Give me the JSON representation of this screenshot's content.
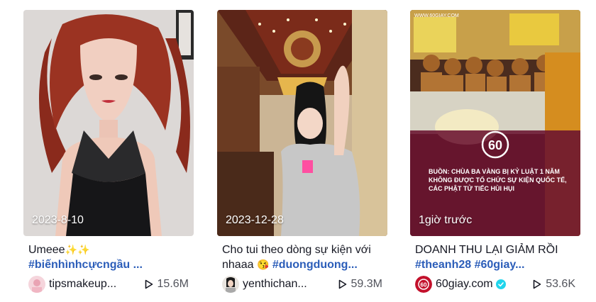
{
  "videos": [
    {
      "date": "2023-8-10",
      "caption_line1": "Umeee",
      "caption_emoji": "✨✨",
      "caption_line2": "#biếnhìnhcựcngầu ...",
      "author": "tipsmakeup...",
      "plays": "15.6M",
      "verified": false,
      "avatar_icon": "makeup-avatar-icon"
    },
    {
      "date": "2023-12-28",
      "caption_line1": "Cho tui theo dòng sự kiện với",
      "caption_line2_prefix": "nhaaa ",
      "caption_emoji": "😘",
      "caption_line2_tag": " #duongduong...",
      "author": "yenthichan...",
      "plays": "59.3M",
      "verified": false,
      "avatar_icon": "user-avatar-icon"
    },
    {
      "date": "1giờ trước",
      "caption_line1": "DOANH THU LẠI GIẢM RỒI",
      "caption_line2": "#theanh28 #60giay...",
      "author": "60giay.com",
      "plays": "53.6K",
      "verified": true,
      "avatar_icon": "60giay-logo-icon",
      "thumb_logo": "60",
      "thumb_headline": [
        "BUỒN: CHÙA BA VÀNG BỊ KỶ LUẬT 1 NĂM",
        "KHÔNG ĐƯỢC TỔ CHỨC SỰ KIỆN QUỐC TẾ,",
        "CÁC PHẬT TỬ TIẾC HÙI HỤI"
      ],
      "thumb_watermark": "WWW.60GIAY.COM"
    }
  ],
  "colors": {
    "hashtag": "#2b5db9",
    "verified": "#20d5ec",
    "text": "#161823"
  }
}
